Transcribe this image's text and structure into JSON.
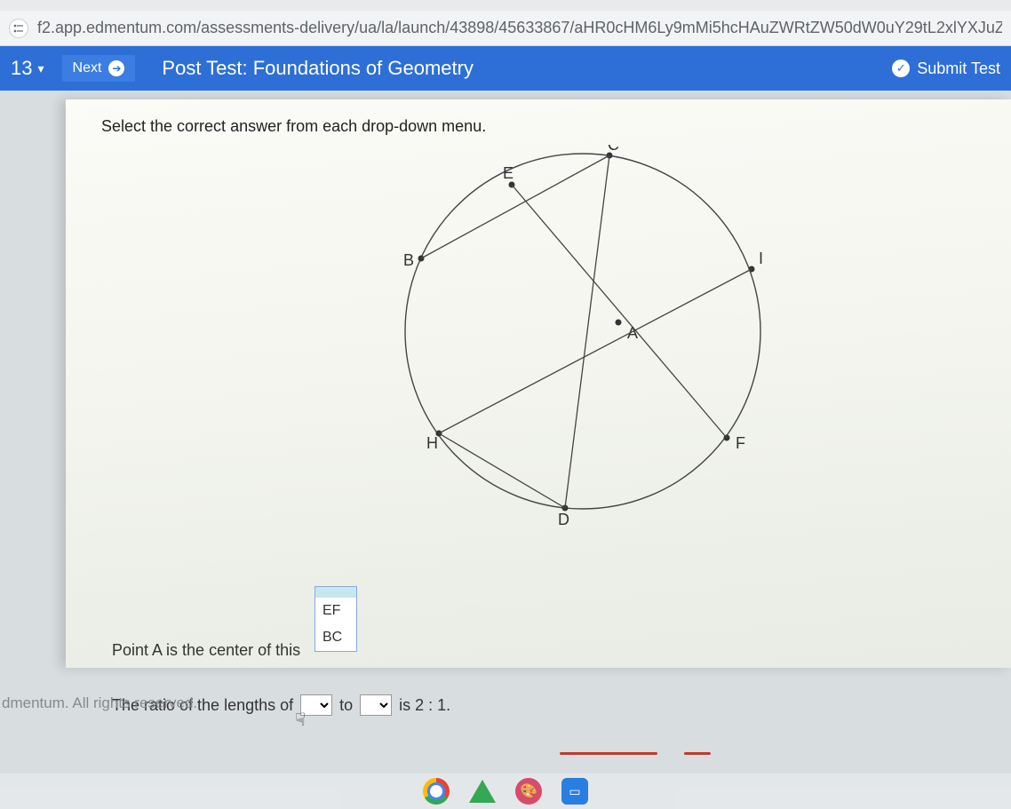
{
  "browser": {
    "url": "f2.app.edmentum.com/assessments-delivery/ua/la/launch/43898/45633867/aHR0cHM6Ly9mMi5hcHAuZWRtZW50dW0uY29tL2xlYXJuZ"
  },
  "header": {
    "question_number": "13",
    "next_label": "Next",
    "test_title": "Post Test: Foundations of Geometry",
    "submit_label": "Submit Test"
  },
  "question": {
    "instruction": "Select the correct answer from each drop-down menu.",
    "line1_prefix": "Point A is the center of this",
    "line2_prefix": "The ratio of the lengths of",
    "line2_mid": "to",
    "line2_suffix": "is 2 : 1."
  },
  "dropdown": {
    "options": [
      "",
      "EF",
      "BC"
    ]
  },
  "diagram": {
    "labels": {
      "A": "A",
      "B": "B",
      "C": "C",
      "D": "D",
      "E": "E",
      "F": "F",
      "H": "H",
      "I": "I"
    }
  },
  "footer": {
    "copyright": "dmentum. All rights reserved."
  }
}
